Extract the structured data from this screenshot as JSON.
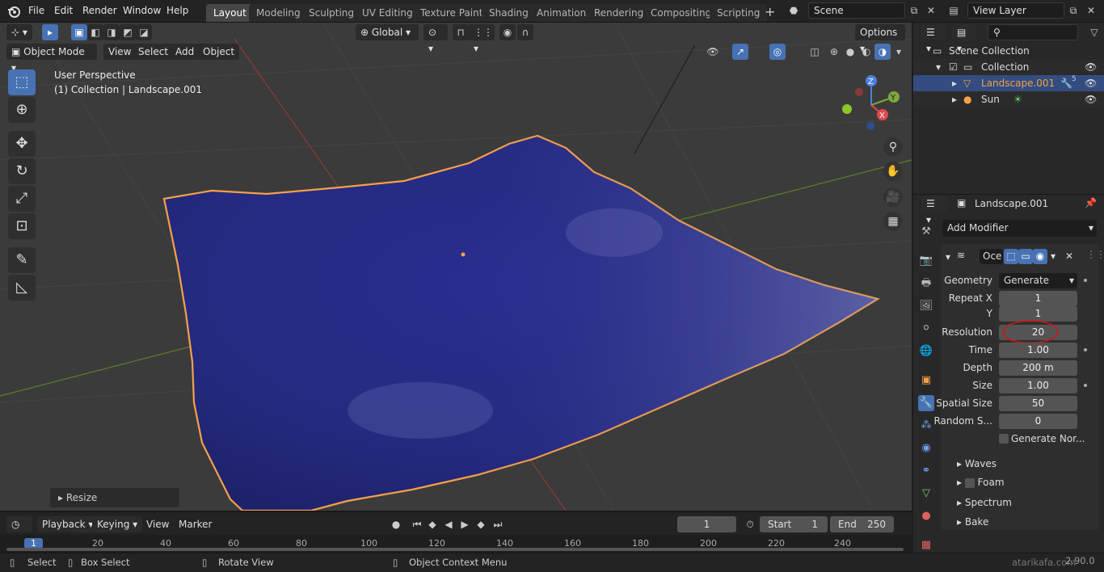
{
  "topbar": {
    "menus": [
      "File",
      "Edit",
      "Render",
      "Window",
      "Help"
    ],
    "workspaces": [
      "Layout",
      "Modeling",
      "Sculpting",
      "UV Editing",
      "Texture Paint",
      "Shading",
      "Animation",
      "Rendering",
      "Compositing",
      "Scripting"
    ],
    "scene_label": "Scene",
    "view_layer_label": "View Layer"
  },
  "viewport_header": {
    "orientation": "Global",
    "options_label": "Options",
    "mode": "Object Mode",
    "menus": [
      "View",
      "Select",
      "Add",
      "Object"
    ]
  },
  "viewport": {
    "perspective": "User Perspective",
    "context": "(1) Collection | Landscape.001",
    "resize_panel": "Resize",
    "gizmo": {
      "z": "Z",
      "y": "Y",
      "x": "X"
    }
  },
  "outliner": {
    "rows": [
      {
        "label": "Scene Collection"
      },
      {
        "label": "Collection"
      },
      {
        "label": "Landscape.001",
        "badge": "5"
      },
      {
        "label": "Sun"
      }
    ]
  },
  "properties": {
    "object_name": "Landscape.001",
    "add_modifier": "Add Modifier",
    "modifier_name": "Oce",
    "fields": [
      {
        "label": "Geometry",
        "value": "Generate"
      },
      {
        "label": "Repeat X",
        "value": "1"
      },
      {
        "label": "Y",
        "value": "1"
      },
      {
        "label": "Resolution",
        "value": "20"
      },
      {
        "label": "Time",
        "value": "1.00"
      },
      {
        "label": "Depth",
        "value": "200 m"
      },
      {
        "label": "Size",
        "value": "1.00"
      },
      {
        "label": "Spatial Size",
        "value": "50"
      },
      {
        "label": "Random S...",
        "value": "0"
      }
    ],
    "generate_normals": "Generate Nor...",
    "subpanels": [
      "Waves",
      "Foam",
      "Spectrum",
      "Bake"
    ],
    "annotation_color": "#d41414"
  },
  "timeline": {
    "menus": [
      "Playback",
      "Keying",
      "View",
      "Marker"
    ],
    "current_frame": "1",
    "start_label": "Start",
    "start_value": "1",
    "end_label": "End",
    "end_value": "250",
    "ticks": [
      "1",
      "20",
      "40",
      "60",
      "80",
      "100",
      "120",
      "140",
      "160",
      "180",
      "200",
      "220",
      "240"
    ]
  },
  "statusbar": {
    "items": [
      "Select",
      "Box Select",
      "Rotate View",
      "Object Context Menu"
    ],
    "version": "2.90.0",
    "watermark": "atarikafa.com"
  },
  "colors": {
    "accent": "#4772b3",
    "selected_object": "#f5a04a",
    "ocean": "#2a2d8f"
  }
}
